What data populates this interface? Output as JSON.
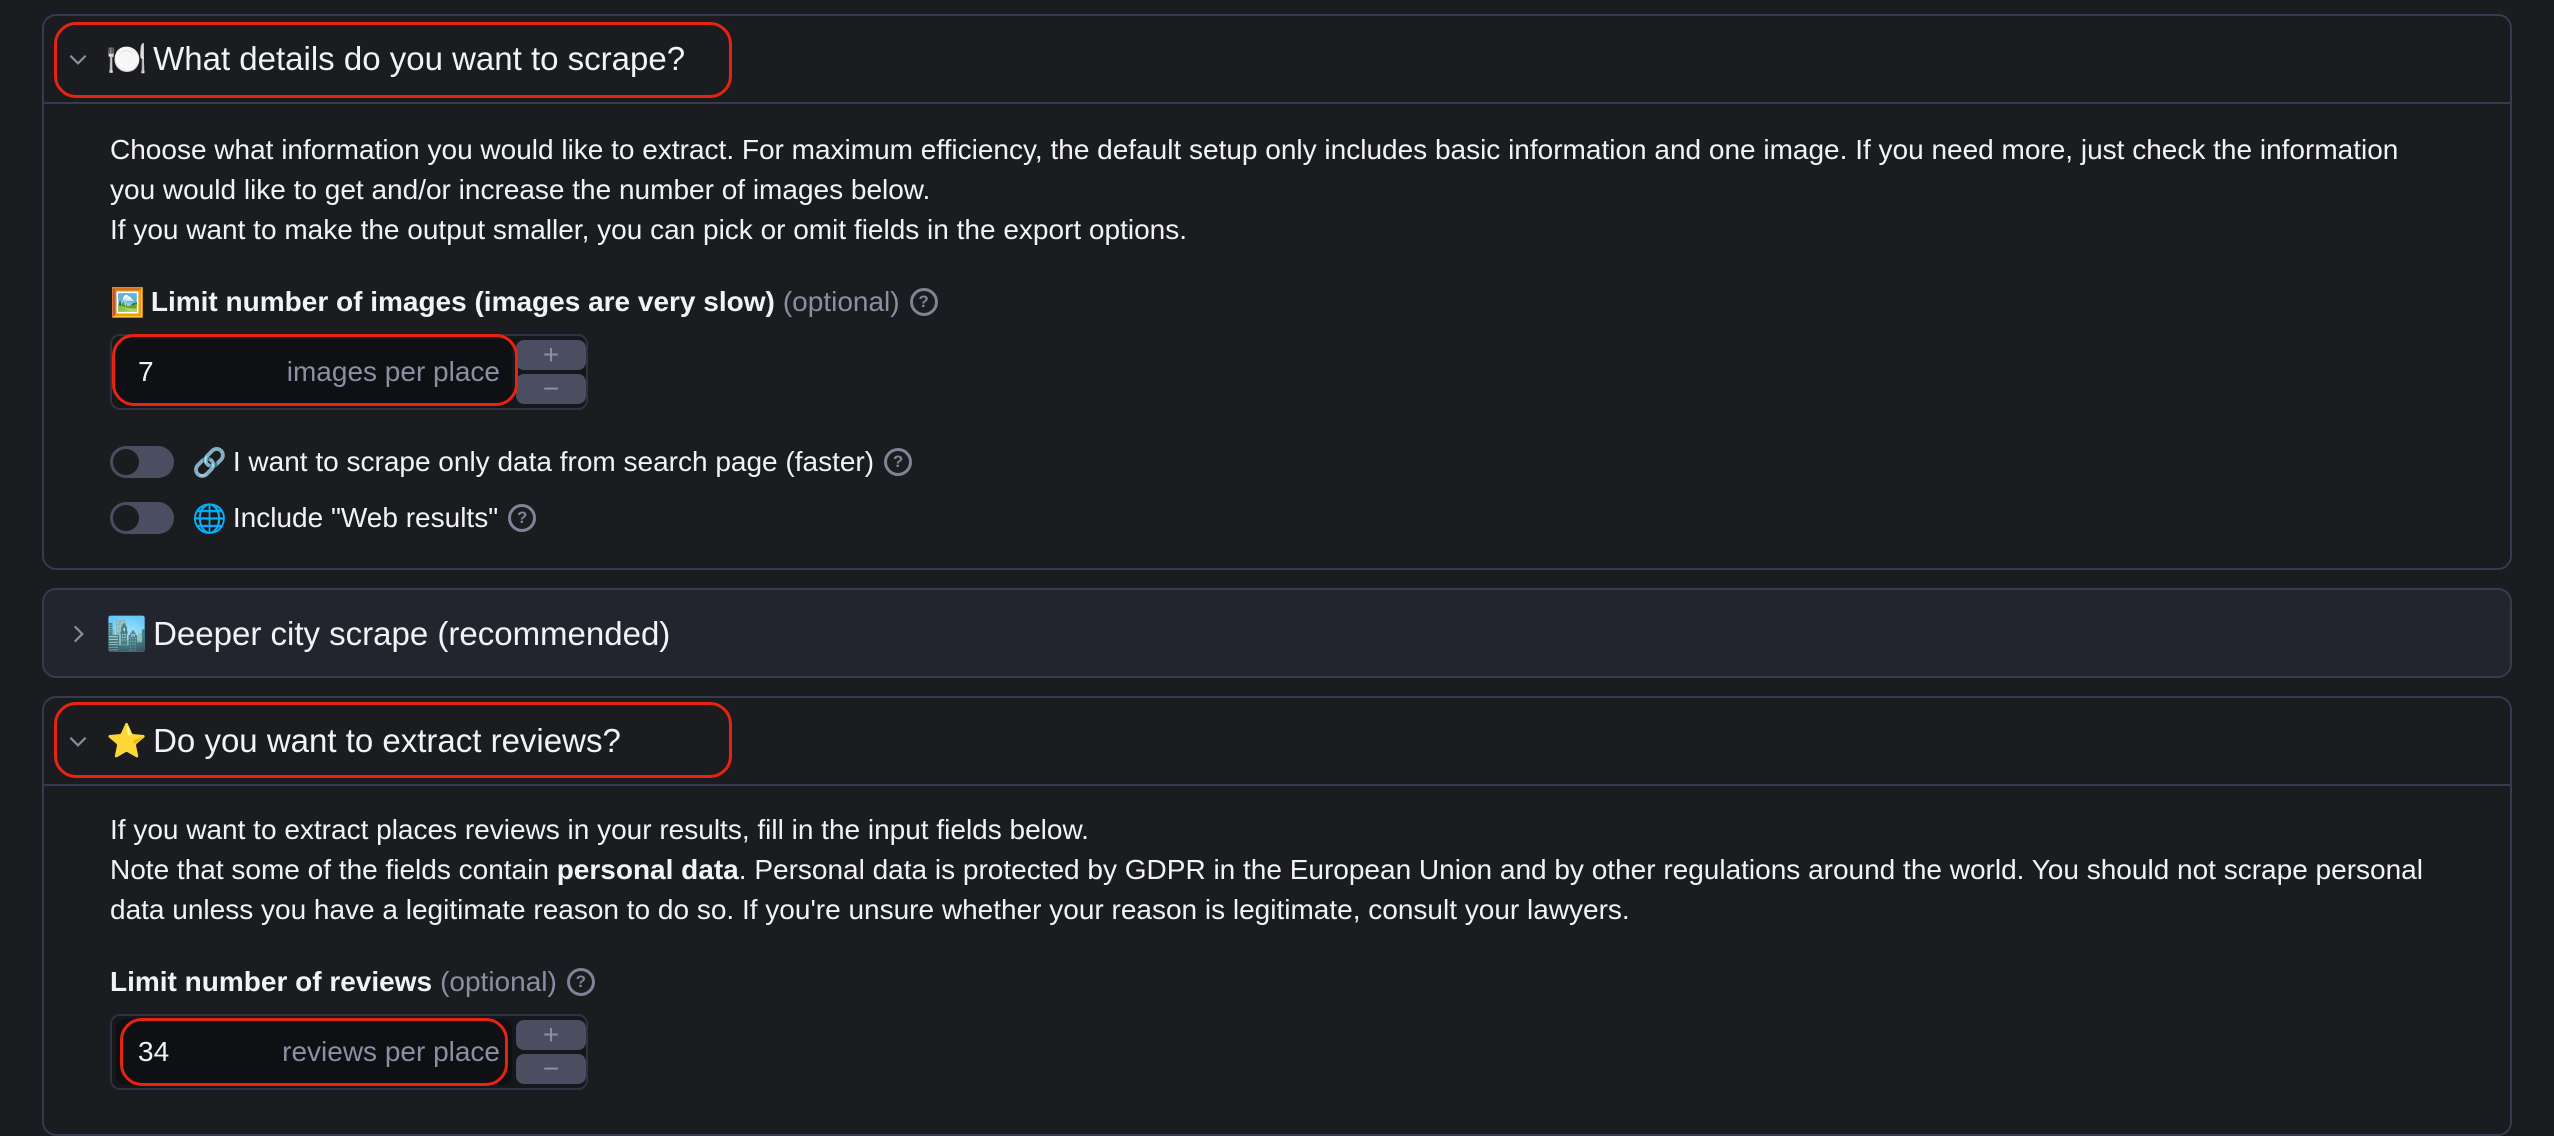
{
  "sections": {
    "details": {
      "icon": "plate-cutlery-icon",
      "emoji": "🍽️",
      "title": "What details do you want to scrape?",
      "expanded": true,
      "description_lines": [
        "Choose what information you would like to extract. For maximum efficiency, the default setup only includes basic information and one image. If you need more, just check the information you would like to get and/or increase the number of images below.",
        "If you want to make the output smaller, you can pick or omit fields in the export options."
      ],
      "images_field": {
        "emoji": "🖼️",
        "icon": "framed-picture-icon",
        "label": "Limit number of images (images are very slow)",
        "optional": "(optional)",
        "value": "7",
        "unit": "images per place",
        "increment": "+",
        "decrement": "−"
      },
      "toggles": [
        {
          "emoji": "🔗",
          "icon": "link-icon",
          "label": "I want to scrape only data from search page (faster)",
          "on": false
        },
        {
          "emoji": "🌐",
          "icon": "globe-icon",
          "label": "Include \"Web results\"",
          "on": false
        }
      ]
    },
    "city": {
      "icon": "cityscape-icon",
      "emoji": "🏙️",
      "title": "Deeper city scrape (recommended)",
      "expanded": false
    },
    "reviews": {
      "icon": "star-icon",
      "emoji": "⭐",
      "title": "Do you want to extract reviews?",
      "expanded": true,
      "line1": "If you want to extract places reviews in your results, fill in the input fields below.",
      "line2_pre": "Note that some of the fields contain ",
      "line2_bold": "personal data",
      "line2_post": ". Personal data is protected by GDPR in the European Union and by other regulations around the world. You should not scrape personal data unless you have a legitimate reason to do so. If you're unsure whether your reason is legitimate, consult your lawyers.",
      "reviews_field": {
        "label": "Limit number of reviews",
        "optional": "(optional)",
        "value": "34",
        "unit": "reviews per place",
        "increment": "+",
        "decrement": "−"
      }
    }
  },
  "colors": {
    "background": "#1b1c20",
    "border": "#363b4e",
    "highlight": "#e8230f",
    "muted_text": "#8a8fa3"
  }
}
